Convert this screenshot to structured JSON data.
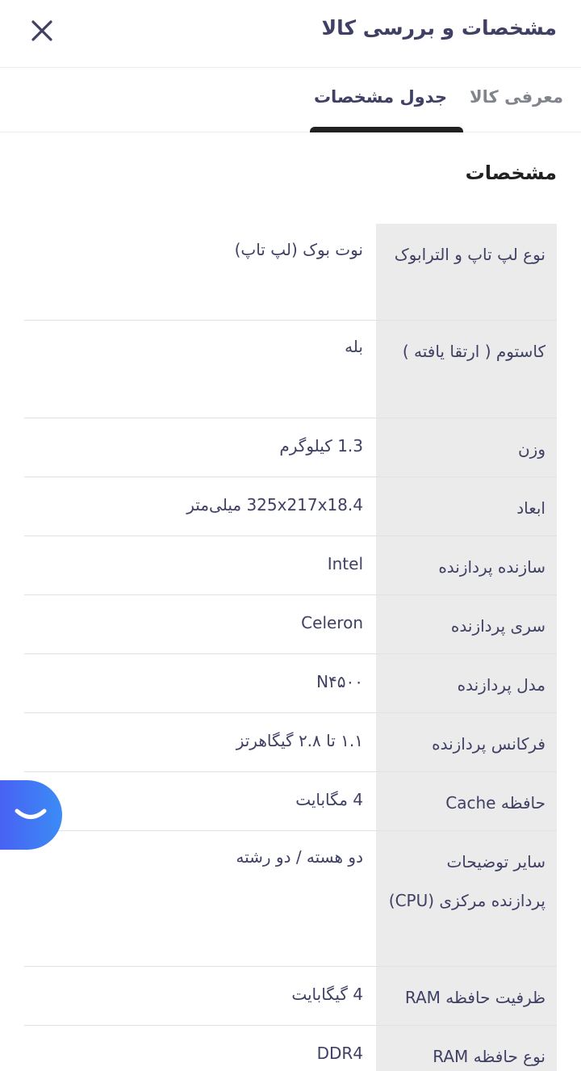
{
  "header": {
    "title": "مشخصات و بررسی کالا",
    "close_icon": "close-icon"
  },
  "tabs": [
    {
      "label": "معرفی کالا",
      "active": false
    },
    {
      "label": "جدول مشخصات",
      "active": true
    }
  ],
  "section": {
    "title": "مشخصات"
  },
  "specs": [
    {
      "key": "نوع لپ تاپ و الترابوک",
      "value": "نوت بوک (لپ تاپ)"
    },
    {
      "key": "کاستوم ( ارتقا یافته )",
      "value": "بله"
    },
    {
      "key": "وزن",
      "value": "1.3 کیلوگرم"
    },
    {
      "key": "ابعاد",
      "value": "325x217x18.4 میلی‌متر"
    },
    {
      "key": "سازنده پردازنده",
      "value": "Intel"
    },
    {
      "key": "سری پردازنده",
      "value": "Celeron"
    },
    {
      "key": "مدل پردازنده",
      "value": "N۴۵۰۰"
    },
    {
      "key": "فرکانس پردازنده",
      "value": "۱.۱ تا ۲.۸ گیگاهرتز"
    },
    {
      "key": "حافظه Cache",
      "value": "4 مگابایت"
    },
    {
      "key": "سایر توضیحات پردازنده مرکزی (CPU)",
      "value": "دو هسته / دو رشته"
    },
    {
      "key": "ظرفیت حافظه RAM",
      "value": "4 گیگابایت"
    },
    {
      "key": "نوع حافظه RAM",
      "value": "DDR4"
    }
  ],
  "chat": {
    "icon": "chat-smile-icon"
  },
  "colors": {
    "text": "#3f4064",
    "muted": "#81858b",
    "key_bg": "#ebebeb",
    "fab_start": "#4a5cf2",
    "fab_end": "#3b8cf6"
  }
}
